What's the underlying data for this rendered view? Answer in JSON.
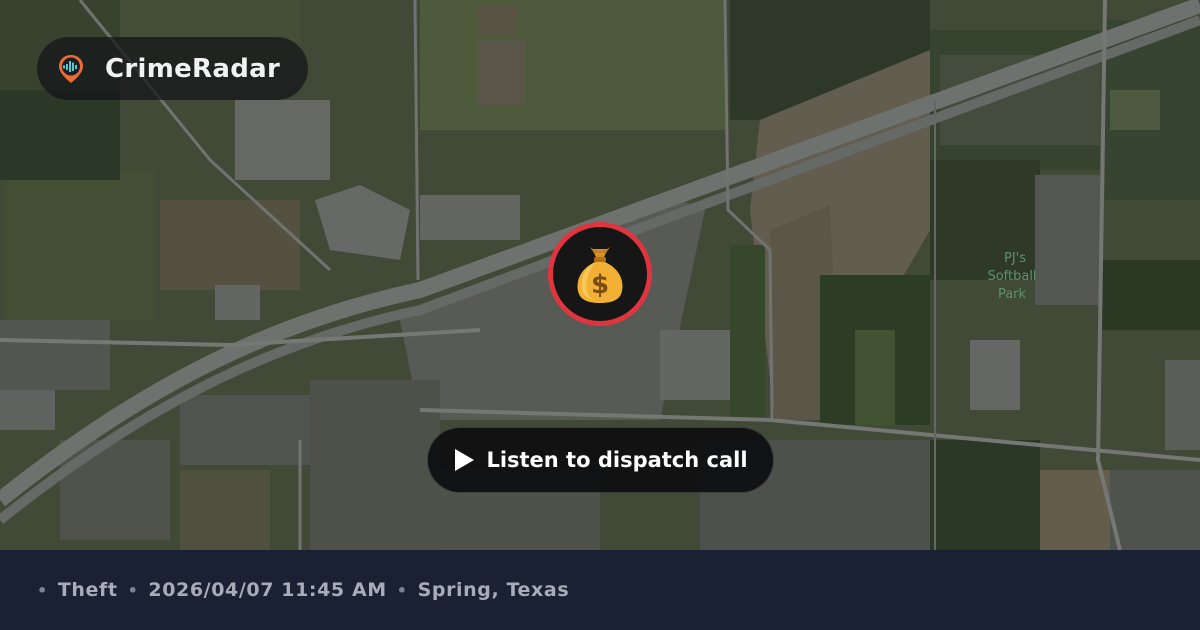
{
  "app": {
    "name": "CrimeRadar",
    "logo_icon": "radar-pin-icon"
  },
  "map": {
    "type": "satellite",
    "poi_label": "PJ's Softball Park"
  },
  "incident": {
    "icon": "money-bag-icon",
    "marker_ring_color": "#e0353f",
    "type": "Theft",
    "datetime": "2026/04/07 11:45 AM",
    "location": "Spring, Texas"
  },
  "player": {
    "button_label": "Listen to dispatch call",
    "icon": "play-icon"
  },
  "footer": {
    "separator": "•"
  }
}
